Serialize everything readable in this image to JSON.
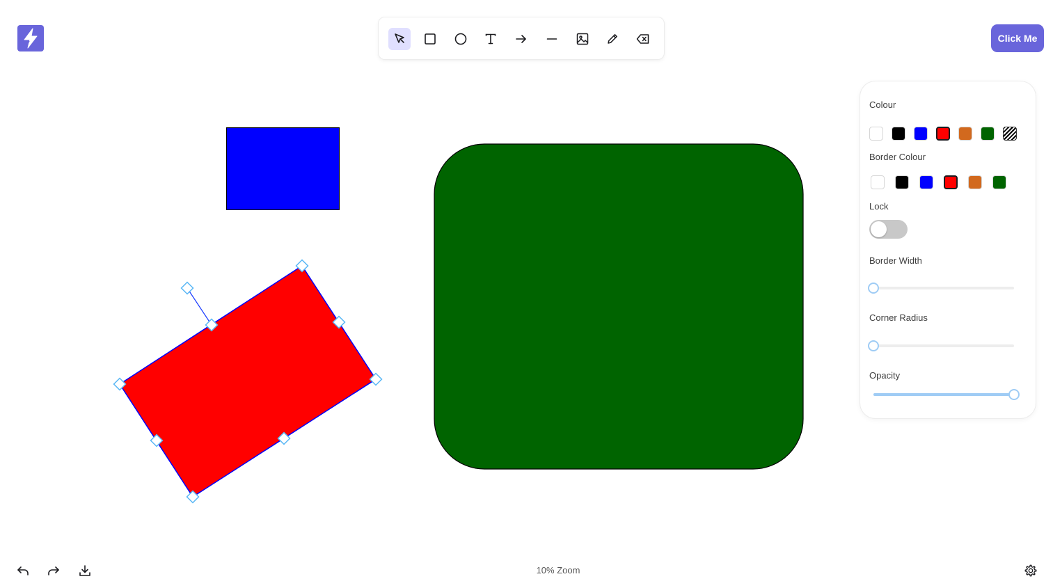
{
  "header": {
    "cta_label": "Click Me"
  },
  "toolbar": {
    "tools": [
      {
        "name": "select",
        "icon": "cursor-icon",
        "active": true
      },
      {
        "name": "rectangle",
        "icon": "rectangle-icon",
        "active": false
      },
      {
        "name": "ellipse",
        "icon": "circle-icon",
        "active": false
      },
      {
        "name": "text",
        "icon": "text-icon",
        "active": false
      },
      {
        "name": "arrow",
        "icon": "arrow-right-icon",
        "active": false
      },
      {
        "name": "line",
        "icon": "line-icon",
        "active": false
      },
      {
        "name": "image",
        "icon": "image-icon",
        "active": false
      },
      {
        "name": "draw",
        "icon": "pencil-icon",
        "active": false
      },
      {
        "name": "eraser",
        "icon": "eraser-icon",
        "active": false
      }
    ]
  },
  "canvas": {
    "shapes": [
      {
        "kind": "rectangle",
        "fill": "#0000ff",
        "stroke": "#000000"
      },
      {
        "kind": "rectangle",
        "fill": "#ff0000",
        "stroke": "#0000ff",
        "selected": true
      },
      {
        "kind": "rounded-rectangle",
        "fill": "#006400",
        "stroke": "#000000"
      }
    ]
  },
  "properties": {
    "colour_label": "Colour",
    "colour_options": [
      "#ffffff",
      "#000000",
      "#0000ff",
      "#ff0000",
      "#d2691e",
      "#006400",
      "transparent"
    ],
    "colour_selected": "#ff0000",
    "border_colour_label": "Border Colour",
    "border_colour_options": [
      "#ffffff",
      "#000000",
      "#0000ff",
      "#ff0000",
      "#d2691e",
      "#006400"
    ],
    "border_colour_selected": "#ff0000",
    "lock_label": "Lock",
    "lock_on": false,
    "border_width_label": "Border Width",
    "border_width_fraction": 0,
    "corner_radius_label": "Corner Radius",
    "corner_radius_fraction": 0,
    "opacity_label": "Opacity",
    "opacity_fraction": 1
  },
  "footer": {
    "zoom_label": "10% Zoom"
  },
  "colors": {
    "accent": "#6965db",
    "active_tool_bg": "#e0dfff",
    "handle": "#5bb8f5"
  }
}
